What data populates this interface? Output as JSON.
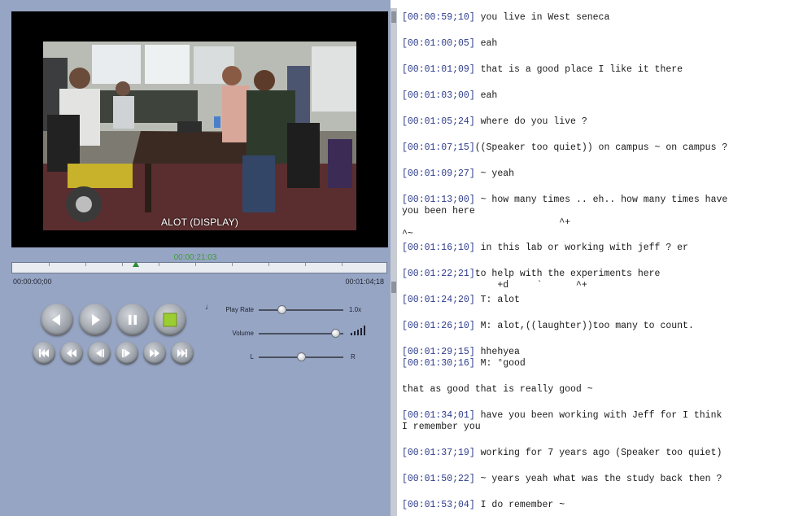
{
  "player": {
    "subtitle": "ALOT (DISPLAY)",
    "current_time": "00:00:21:03",
    "start_time": "00:00:00;00",
    "end_time": "00:01:04;18",
    "play_rate_label": "Play Rate",
    "play_rate_value": "1.0x",
    "volume_label": "Volume",
    "balance_left": "L",
    "balance_right": "R",
    "progress": 0.33,
    "play_rate_level": 0.25,
    "volume_level": 0.96,
    "balance_level": 0.5
  },
  "transcript": {
    "lines": [
      {
        "ts": "[00:00:59;10]",
        "text": " you live in West seneca"
      },
      {
        "ts": "[00:01:00;05]",
        "text": " eah"
      },
      {
        "ts": "[00:01:01;09]",
        "text": " that is a good place I like it there"
      },
      {
        "ts": "[00:01:03;00]",
        "text": " eah"
      },
      {
        "ts": "[00:01:05;24]",
        "text": " where do you live ?"
      },
      {
        "ts": "[00:01:07;15]",
        "text": "((Speaker too quiet)) on campus ~ on campus ?"
      },
      {
        "ts": "[00:01:09;27]",
        "text": " ~ yeah"
      },
      {
        "ts": "[00:01:13;00]",
        "text": " ~ how many times .. eh.. how many times have"
      },
      {
        "ts": "",
        "text": "you been here"
      },
      {
        "ts": "",
        "text": "                            ^+"
      },
      {
        "ts": "",
        "text": "^~"
      },
      {
        "ts": "[00:01:16;10]",
        "text": " in this lab or working with jeff ? er"
      },
      {
        "ts": "[00:01:22;21]",
        "text": "to help with the experiments here"
      },
      {
        "ts": "",
        "text": "                 +d     `      ^+"
      },
      {
        "ts": "[00:01:24;20]",
        "text": " T: alot"
      },
      {
        "ts": "[00:01:26;10]",
        "text": " M: alot,((laughter))too many to count."
      },
      {
        "ts": "[00:01:29;15]",
        "text": " hhehyea"
      },
      {
        "ts": "[00:01:30;16]",
        "text": " M: °good"
      },
      {
        "ts": "",
        "text": "that as good that is really good ~"
      },
      {
        "ts": "[00:01:34;01]",
        "text": " have you been working with Jeff for I think"
      },
      {
        "ts": "",
        "text": "I remember you"
      },
      {
        "ts": "[00:01:37;19]",
        "text": " working for 7 years ago (Speaker too quiet)"
      },
      {
        "ts": "[00:01:50;22]",
        "text": " ~ years yeah what was the study back then ?"
      },
      {
        "ts": "[00:01:53;04]",
        "text": " I do remember ~"
      }
    ]
  }
}
